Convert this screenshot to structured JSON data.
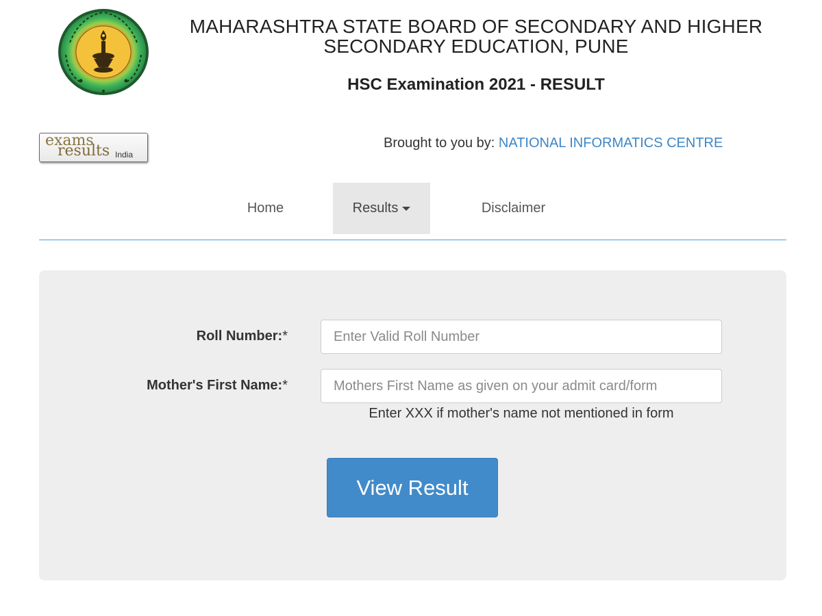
{
  "header": {
    "board_line1": "MAHARASHTRA STATE BOARD OF SECONDARY AND HIGHER",
    "board_line2": "SECONDARY EDUCATION, PUNE",
    "exam_title": "HSC Examination 2021 - RESULT"
  },
  "logo": {
    "word1": "exams",
    "word2": "results",
    "word3": "India"
  },
  "credit": {
    "prefix": "Brought to you by: ",
    "organization": "NATIONAL INFORMATICS CENTRE"
  },
  "nav": {
    "home": "Home",
    "results": "Results",
    "disclaimer": "Disclaimer"
  },
  "form": {
    "roll_label": "Roll Number:",
    "roll_required": "*",
    "roll_placeholder": "Enter Valid Roll Number",
    "roll_value": "",
    "mother_label": "Mother's First Name:",
    "mother_required": "*",
    "mother_placeholder": "Mothers First Name as given on your admit card/form",
    "mother_value": "",
    "hint": "Enter XXX if mother's name not mentioned in form",
    "submit_label": "View Result"
  },
  "colors": {
    "accent": "#428bca",
    "link": "#3d86c6",
    "panel": "#eeeeee",
    "nav_active": "#e7e7e7"
  }
}
